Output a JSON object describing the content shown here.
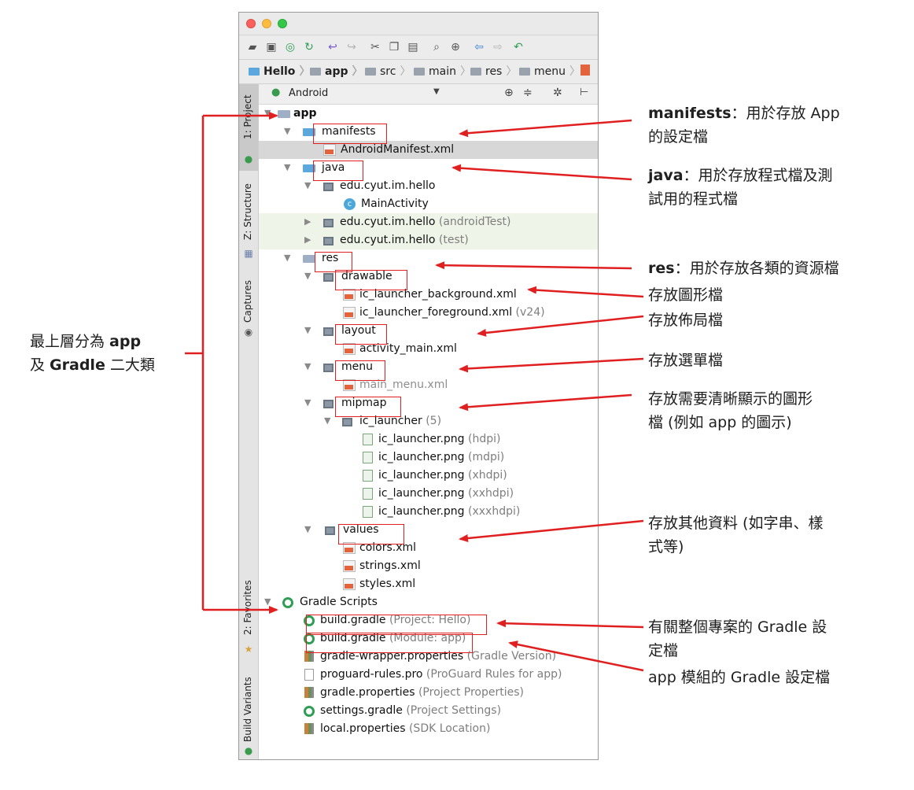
{
  "toolbar": {
    "icons": [
      "open-folder-icon",
      "save-icon",
      "sync-icon",
      "sync-gradle-icon",
      "undo-icon",
      "redo-icon",
      "cut-icon",
      "copy-icon",
      "paste-icon",
      "find-icon",
      "replace-icon",
      "back-icon",
      "forward-icon",
      "build-icon"
    ]
  },
  "navbar": {
    "crumbs": [
      "Hello",
      "app",
      "src",
      "main",
      "res",
      "menu"
    ]
  },
  "sidebar": {
    "tabs": [
      "1: Project",
      "Z: Structure",
      "Captures",
      "2: Favorites",
      "Build Variants"
    ]
  },
  "panel": {
    "view_mode": "Android"
  },
  "tree": [
    {
      "label": "app",
      "sub": "",
      "bold": true
    },
    {
      "label": "manifests",
      "sub": ""
    },
    {
      "label": "AndroidManifest.xml",
      "sub": ""
    },
    {
      "label": "java",
      "sub": ""
    },
    {
      "label": "edu.cyut.im.hello",
      "sub": ""
    },
    {
      "label": "MainActivity",
      "sub": ""
    },
    {
      "label": "edu.cyut.im.hello",
      "sub": " (androidTest)"
    },
    {
      "label": "edu.cyut.im.hello",
      "sub": " (test)"
    },
    {
      "label": "res",
      "sub": ""
    },
    {
      "label": "drawable",
      "sub": ""
    },
    {
      "label": "ic_launcher_background.xml",
      "sub": ""
    },
    {
      "label": "ic_launcher_foreground.xml",
      "sub": " (v24)"
    },
    {
      "label": "layout",
      "sub": ""
    },
    {
      "label": "activity_main.xml",
      "sub": ""
    },
    {
      "label": "menu",
      "sub": ""
    },
    {
      "label": "main_menu.xml",
      "sub": ""
    },
    {
      "label": "mipmap",
      "sub": ""
    },
    {
      "label": "ic_launcher",
      "sub": " (5)"
    },
    {
      "label": "ic_launcher.png",
      "sub": " (hdpi)"
    },
    {
      "label": "ic_launcher.png",
      "sub": " (mdpi)"
    },
    {
      "label": "ic_launcher.png",
      "sub": " (xhdpi)"
    },
    {
      "label": "ic_launcher.png",
      "sub": " (xxhdpi)"
    },
    {
      "label": "ic_launcher.png",
      "sub": " (xxxhdpi)"
    },
    {
      "label": "values",
      "sub": ""
    },
    {
      "label": "colors.xml",
      "sub": ""
    },
    {
      "label": "strings.xml",
      "sub": ""
    },
    {
      "label": "styles.xml",
      "sub": ""
    },
    {
      "label": "Gradle Scripts",
      "sub": ""
    },
    {
      "label": "build.gradle",
      "sub": " (Project: Hello)"
    },
    {
      "label": "build.gradle",
      "sub": " (Module: app)"
    },
    {
      "label": "gradle-wrapper.properties",
      "sub": " (Gradle Version)"
    },
    {
      "label": "proguard-rules.pro",
      "sub": " (ProGuard Rules for app)"
    },
    {
      "label": "gradle.properties",
      "sub": " (Project Properties)"
    },
    {
      "label": "settings.gradle",
      "sub": " (Project Settings)"
    },
    {
      "label": "local.properties",
      "sub": " (SDK Location)"
    }
  ],
  "notes": {
    "left": [
      "最上層分為 ",
      "app",
      "及 ",
      "Gradle",
      " 二大類"
    ],
    "manifests": [
      "manifests",
      "：用於存放 App",
      "的設定檔"
    ],
    "java": [
      "java",
      "：用於存放程式檔及測",
      "試用的程式檔"
    ],
    "res": [
      "res",
      "：用於存放各類的資源檔"
    ],
    "drawable": "存放圖形檔",
    "layout": "存放佈局檔",
    "menu": "存放選單檔",
    "mipmap": [
      "存放需要清晰顯示的圖形",
      "檔 (例如 app 的圖示)"
    ],
    "values": [
      "存放其他資料 (如字串、樣",
      "式等)"
    ],
    "project_gradle": [
      "有關整個專案的 Gradle 設",
      "定檔"
    ],
    "module_gradle": "app 模組的 Gradle 設定檔"
  },
  "colors": {
    "annotation_red": "#e02020",
    "selection": "#d7d7d7",
    "test_highlight": "#eef5e8"
  }
}
